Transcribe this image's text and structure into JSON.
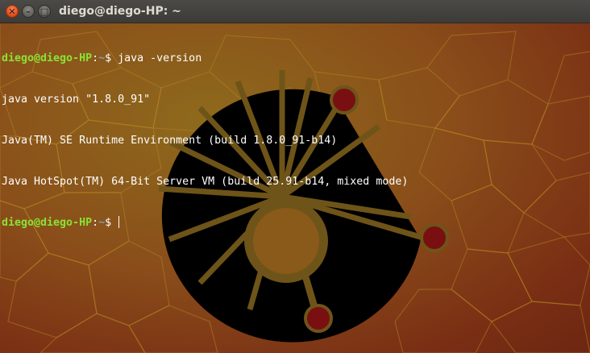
{
  "window": {
    "title": "diego@diego-HP: ~",
    "buttons": {
      "close_glyph": "✕",
      "minimize_glyph": "–",
      "maximize_glyph": "□"
    }
  },
  "colors": {
    "prompt_user": "#8ae234",
    "prompt_path": "#729fcf",
    "terminal_text": "#ffffff",
    "logo_dots": "#7a0f12",
    "logo_fill": "#000000"
  },
  "terminal": {
    "lines": [
      {
        "type": "prompt",
        "user_host": "diego@diego-HP",
        "sep": ":",
        "path": "~",
        "symbol": "$ ",
        "command": "java -version"
      },
      {
        "type": "output",
        "text": "java version \"1.8.0_91\""
      },
      {
        "type": "output",
        "text": "Java(TM) SE Runtime Environment (build 1.8.0_91-b14)"
      },
      {
        "type": "output",
        "text": "Java HotSpot(TM) 64-Bit Server VM (build 25.91-b14, mixed mode)"
      },
      {
        "type": "prompt",
        "user_host": "diego@diego-HP",
        "sep": ":",
        "path": "~",
        "symbol": "$ ",
        "command": ""
      }
    ]
  },
  "background": {
    "wallpaper_icon": "unicamp-logo-icon"
  }
}
